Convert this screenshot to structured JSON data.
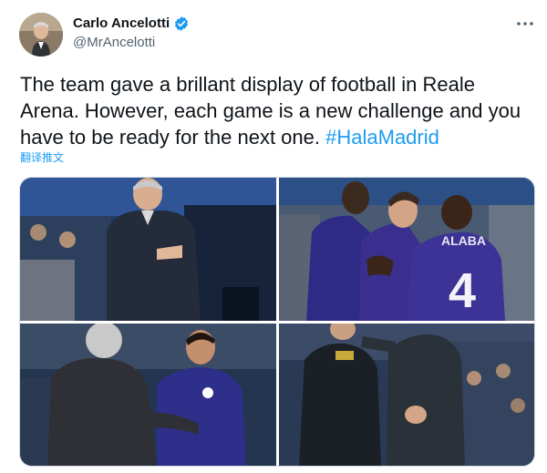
{
  "author": {
    "display_name": "Carlo Ancelotti",
    "handle": "@MrAncelotti",
    "verified": true,
    "avatar_icon": "profile-photo"
  },
  "tweet": {
    "text_before_hashtag": "The team gave a brillant display of football in Reale Arena. However, each game is a new challenge and you have to be ready for the next one.",
    "hashtag": "#HalaMadrid",
    "translate_label": "翻译推文"
  },
  "media": {
    "photos": [
      {
        "name": "coach-standing-photo"
      },
      {
        "name": "players-celebrating-photo",
        "jersey_name": "ALABA",
        "jersey_number": "4"
      },
      {
        "name": "coach-hugging-player-photo"
      },
      {
        "name": "coach-handshake-photo"
      }
    ]
  },
  "colors": {
    "accent": "#1d9bf0",
    "text_primary": "#0f1419",
    "text_secondary": "#536471",
    "kit_purple": "#3a2f8f"
  }
}
